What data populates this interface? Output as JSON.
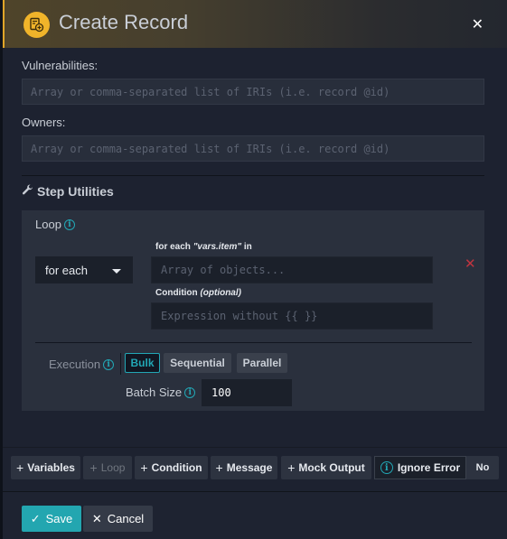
{
  "modal": {
    "title": "Create Record",
    "header_icon": "record-add-icon",
    "close_icon": "close-icon",
    "close_glyph": "✕",
    "accent_color": "#f0b42a"
  },
  "fields": [
    {
      "label": "Vulnerabilities:",
      "value": "",
      "placeholder": "Array or comma-separated list of IRIs (i.e. record @id)"
    },
    {
      "label": "Owners:",
      "value": "",
      "placeholder": "Array or comma-separated list of IRIs (i.e. record @id)"
    }
  ],
  "step_utilities": {
    "title": "Step Utilities",
    "icon": "wrench-icon",
    "loop": {
      "label": "Loop",
      "info_glyph": "i",
      "mode": "for each",
      "for_each_label_prefix": "for each ",
      "for_each_var": "\"vars.item\"",
      "for_each_label_suffix": " in",
      "array_value": "",
      "array_placeholder": "Array of objects...",
      "condition_label": "Condition ",
      "condition_optional": "(optional)",
      "condition_value": "",
      "condition_placeholder": "Expression without {{ }}",
      "remove_glyph": "✕",
      "remove_color": "#c0343f",
      "execution_label": "Execution",
      "execution_options": [
        "Bulk",
        "Sequential",
        "Parallel"
      ],
      "execution_selected": "Bulk",
      "batch_size_label": "Batch Size",
      "batch_size": "100"
    }
  },
  "toolbar": {
    "buttons": [
      {
        "label": "Variables",
        "enabled": true
      },
      {
        "label": "Loop",
        "enabled": false
      },
      {
        "label": "Condition",
        "enabled": true
      },
      {
        "label": "Message",
        "enabled": true
      },
      {
        "label": "Mock Output",
        "enabled": true
      }
    ],
    "plus_glyph": "+",
    "ignore_error_label": "Ignore Error",
    "ignore_error_value": "No"
  },
  "footer": {
    "save_label": "Save",
    "save_glyph": "✓",
    "cancel_label": "Cancel",
    "cancel_glyph": "✕",
    "primary_color": "#23a6b0"
  }
}
